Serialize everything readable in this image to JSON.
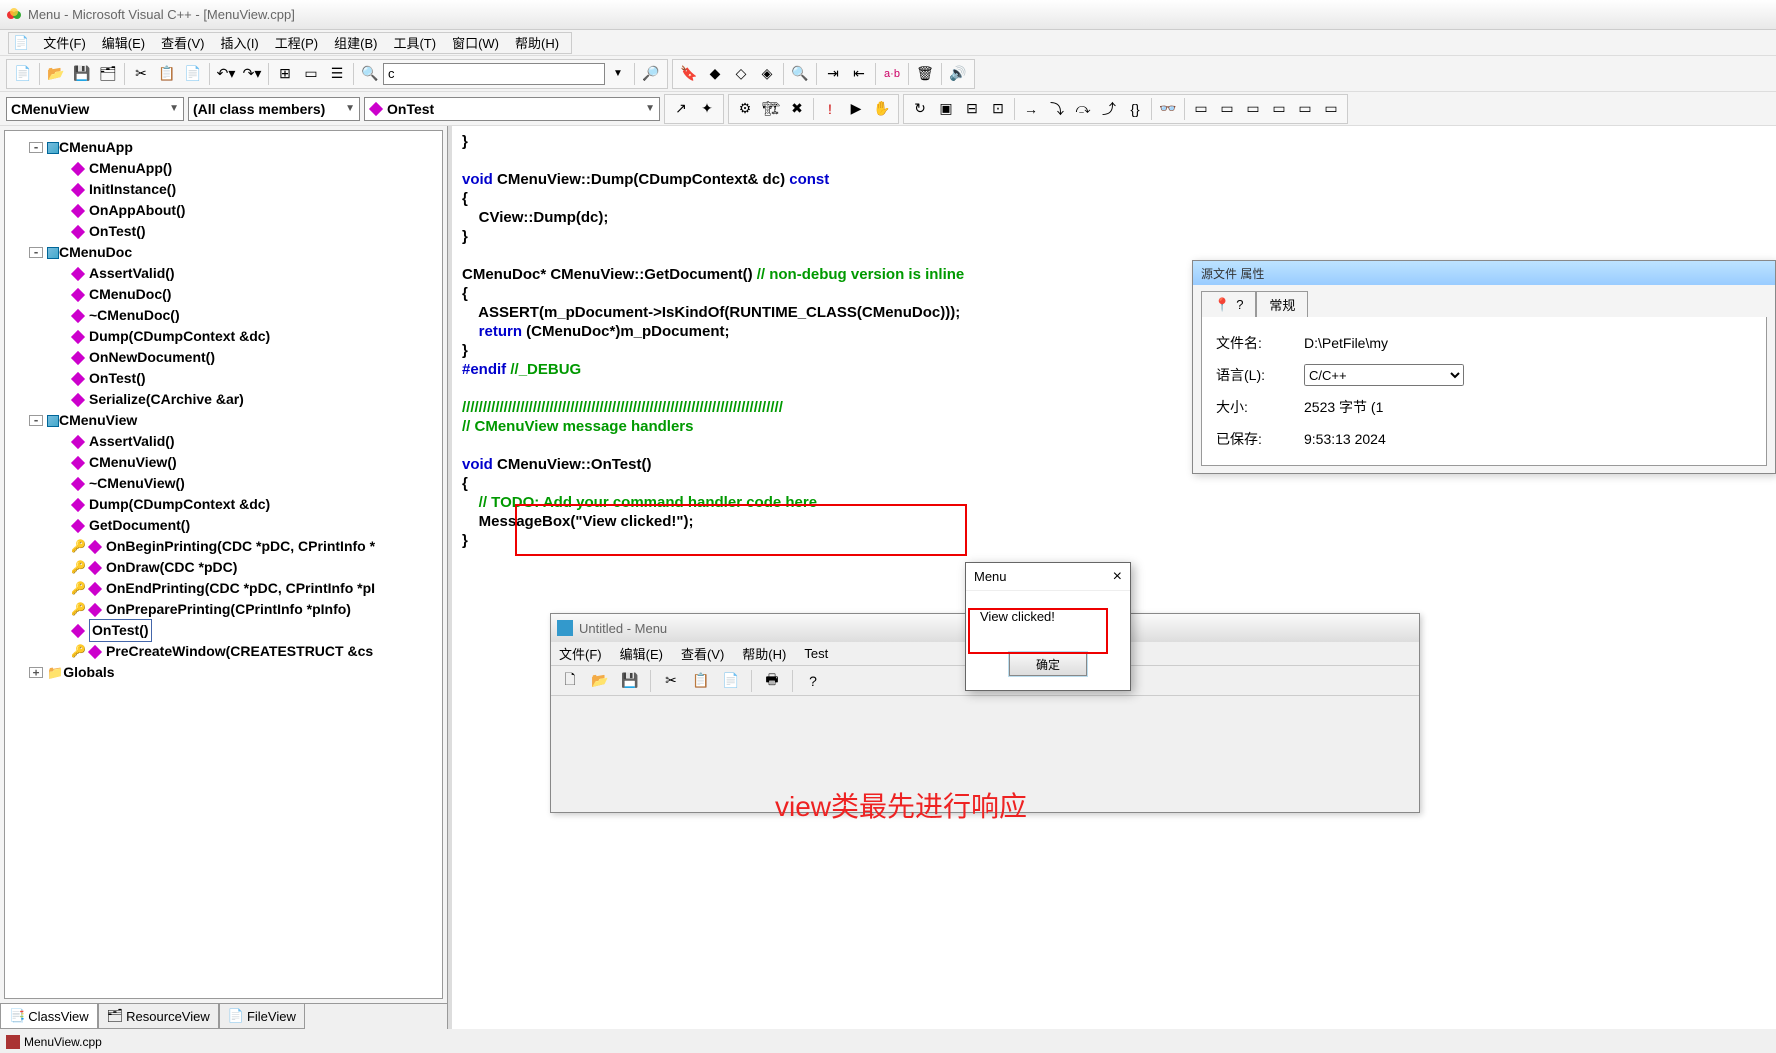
{
  "title": "Menu - Microsoft Visual C++ - [MenuView.cpp]",
  "menubar": [
    "文件(F)",
    "编辑(E)",
    "查看(V)",
    "插入(I)",
    "工程(P)",
    "组建(B)",
    "工具(T)",
    "窗口(W)",
    "帮助(H)"
  ],
  "search_value": "c",
  "combos": {
    "class": "CMenuView",
    "filter": "(All class members)",
    "member": "OnTest"
  },
  "tree": {
    "c0": "CMenuApp",
    "c0m": [
      "CMenuApp()",
      "InitInstance()",
      "OnAppAbout()",
      "OnTest()"
    ],
    "c1": "CMenuDoc",
    "c1m": [
      "AssertValid()",
      "CMenuDoc()",
      "~CMenuDoc()",
      "Dump(CDumpContext &dc)",
      "OnNewDocument()",
      "OnTest()",
      "Serialize(CArchive &ar)"
    ],
    "c2": "CMenuView",
    "c2m": [
      "AssertValid()",
      "CMenuView()",
      "~CMenuView()",
      "Dump(CDumpContext &dc)",
      "GetDocument()",
      "OnBeginPrinting(CDC *pDC, CPrintInfo *",
      "OnDraw(CDC *pDC)",
      "OnEndPrinting(CDC *pDC, CPrintInfo *pI",
      "OnPreparePrinting(CPrintInfo *pInfo)",
      "OnTest()",
      "PreCreateWindow(CREATESTRUCT &cs"
    ],
    "globals": "Globals"
  },
  "tree_selected": "OnTest()",
  "sidebar_tabs": [
    "ClassView",
    "ResourceView",
    "FileView"
  ],
  "code_lines": [
    {
      "t": "}"
    },
    {
      "t": ""
    },
    {
      "seg": [
        {
          "k": "kw",
          "t": "void"
        },
        {
          "t": " CMenuView::Dump(CDumpContext& dc) "
        },
        {
          "k": "kw",
          "t": "const"
        }
      ]
    },
    {
      "t": "{"
    },
    {
      "t": "    CView::Dump(dc);"
    },
    {
      "t": "}"
    },
    {
      "t": ""
    },
    {
      "seg": [
        {
          "t": "CMenuDoc* CMenuView::GetDocument() "
        },
        {
          "k": "cm",
          "t": "// non-debug version is inline"
        }
      ]
    },
    {
      "t": "{"
    },
    {
      "t": "    ASSERT(m_pDocument->IsKindOf(RUNTIME_CLASS(CMenuDoc)));"
    },
    {
      "seg": [
        {
          "t": "    "
        },
        {
          "k": "kw",
          "t": "return"
        },
        {
          "t": " (CMenuDoc*)m_pDocument;"
        }
      ]
    },
    {
      "t": "}"
    },
    {
      "seg": [
        {
          "k": "pp",
          "t": "#endif"
        },
        {
          "t": " "
        },
        {
          "k": "cm",
          "t": "//_DEBUG"
        }
      ]
    },
    {
      "t": ""
    },
    {
      "k": "cm",
      "t": "/////////////////////////////////////////////////////////////////////////////"
    },
    {
      "k": "cm",
      "t": "// CMenuView message handlers"
    },
    {
      "t": ""
    },
    {
      "seg": [
        {
          "k": "kw",
          "t": "void"
        },
        {
          "t": " CMenuView::OnTest()"
        }
      ]
    },
    {
      "t": "{"
    },
    {
      "seg": [
        {
          "t": "    "
        },
        {
          "k": "cm",
          "t": "// TODO: Add your command handler code here"
        }
      ]
    },
    {
      "t": "    MessageBox(\"View clicked!\");"
    },
    {
      "t": "}"
    }
  ],
  "child_window": {
    "title": "Untitled - Menu",
    "menu": [
      "文件(F)",
      "编辑(E)",
      "查看(V)",
      "帮助(H)",
      "Test"
    ]
  },
  "msgbox": {
    "title": "Menu",
    "body": "View clicked!",
    "ok": "确定",
    "close": "×"
  },
  "prop": {
    "title": "源文件 属性",
    "tab": "常规",
    "rows": {
      "file": "文件名:",
      "file_v": "D:\\PetFile\\my",
      "lang": "语言(L):",
      "lang_v": "C/C++",
      "size": "大小:",
      "size_v": "2523 字节 (1",
      "saved": "已保存:",
      "saved_v": "9:53:13 2024"
    }
  },
  "annotation": "view类最先进行响应",
  "status_file": "MenuView.cpp"
}
